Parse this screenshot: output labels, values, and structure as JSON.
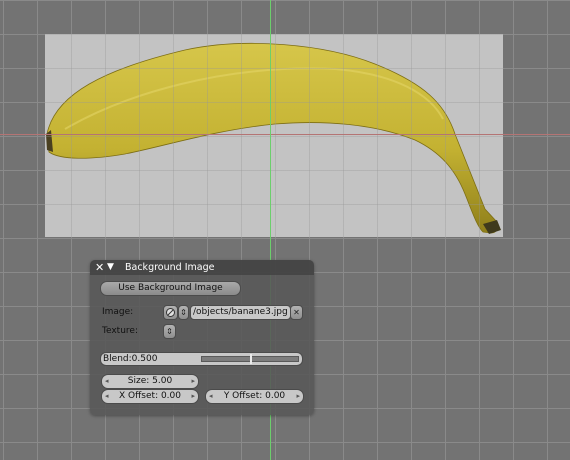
{
  "panel": {
    "title": "Background Image",
    "use_button_label": "Use Background Image",
    "image_label": "Image:",
    "image_path": "/objects/banane3.jpg",
    "texture_label": "Texture:",
    "blend_label": "Blend:",
    "blend_value": "0.500",
    "blend_fraction": 0.5,
    "size_label": "Size: 5.00",
    "x_offset_label": "X Offset: 0.00",
    "y_offset_label": "Y Offset: 0.00"
  },
  "icons": {
    "close": "close-icon",
    "collapse": "triangle-down-icon",
    "image_browse": "image-icon",
    "clear": "x-icon",
    "texture_browse": "updown-icon"
  },
  "colors": {
    "viewport_bg": "#737373",
    "grid_line": "#8a8a8a",
    "x_axis": "#b47474",
    "y_axis": "#6ccf6c",
    "panel_bg": "#585858",
    "banana": "#c7b634"
  }
}
